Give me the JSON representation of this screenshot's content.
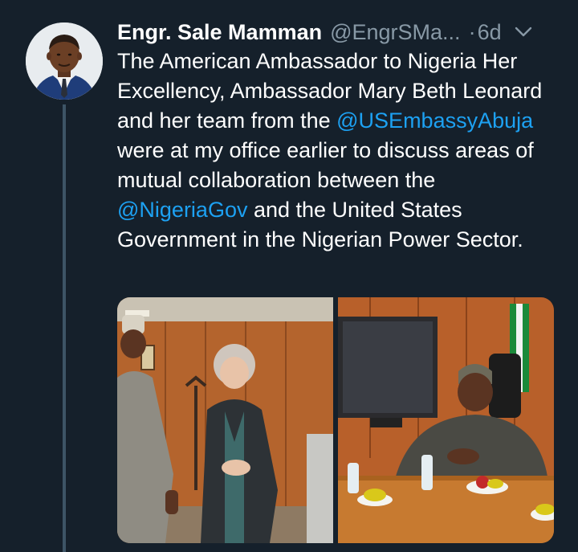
{
  "tweet": {
    "author_name": "Engr. Sale Mamman",
    "author_handle": "@EngrSMa...",
    "time_separator": "·",
    "time": "6d",
    "text_parts": [
      "The American Ambassador to Nigeria Her Excellency, Ambassador Mary Beth Leonard and her team from the ",
      "@USEmbassyAbuja",
      " were at my office earlier to discuss areas of mutual collaboration between the ",
      "@NigeriaGov",
      " and the United States Government in the Nigerian Power Sector."
    ],
    "photo_count": 2
  },
  "colors": {
    "background": "#15202b",
    "text": "#ffffff",
    "secondary_text": "#8899a6",
    "link": "#1da1f2",
    "thread_line": "#3d5466"
  },
  "icons": {
    "caret": "chevron-down-icon"
  }
}
